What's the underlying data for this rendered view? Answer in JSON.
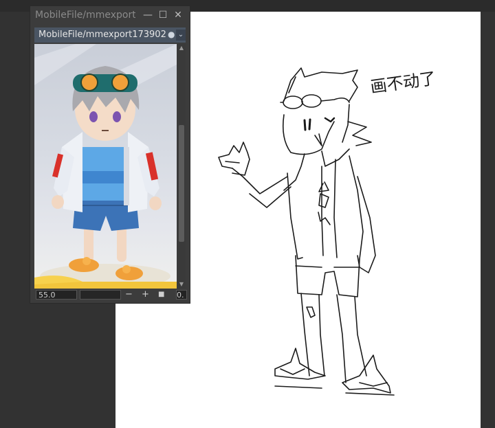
{
  "reference_window": {
    "title": "MobileFile/mmexport173902",
    "tab_label": "MobileFile/mmexport173902",
    "tab_modified_dot": "●",
    "dropdown_glyph": "⌄",
    "window_buttons": {
      "minimize": "—",
      "maximize": "☐",
      "close": "✕"
    },
    "zoom_value": "55.0",
    "zoom_out": "−",
    "zoom_in": "+",
    "reset_glyph": "■",
    "rotation_value": "0."
  },
  "canvas": {
    "annotation_text": "画不动了"
  },
  "colors": {
    "app_bg": "#323232",
    "panel_bg": "#3c3c3c",
    "tab_bg": "#4a5563",
    "paper": "#ffffff",
    "ink": "#1a1a1a"
  },
  "icons": [
    "minimize-icon",
    "maximize-icon",
    "close-icon",
    "dropdown-icon",
    "scroll-up-icon",
    "scroll-down-icon"
  ]
}
